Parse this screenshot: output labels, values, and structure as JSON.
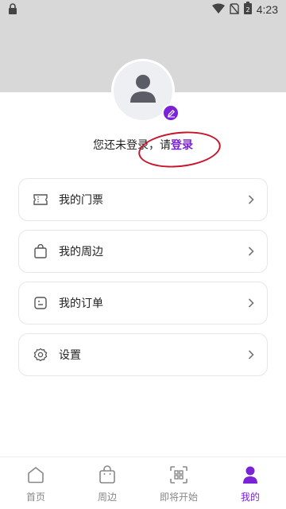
{
  "status_bar": {
    "time": "4:23"
  },
  "profile": {
    "login_prompt": "您还未登录，请",
    "login_link": "登录"
  },
  "menu": [
    {
      "label": "我的门票",
      "icon": "ticket-icon"
    },
    {
      "label": "我的周边",
      "icon": "shopping-bag-icon"
    },
    {
      "label": "我的订单",
      "icon": "order-icon"
    },
    {
      "label": "设置",
      "icon": "gear-icon"
    }
  ],
  "bottom_nav": [
    {
      "label": "首页",
      "icon": "home-icon",
      "active": false
    },
    {
      "label": "周边",
      "icon": "shopping-bag-icon",
      "active": false
    },
    {
      "label": "即将开始",
      "icon": "qr-scan-icon",
      "active": false
    },
    {
      "label": "我的",
      "icon": "person-icon",
      "active": true
    }
  ],
  "colors": {
    "accent": "#7a22d8",
    "header_gray": "#d8d8d8",
    "annotation_red": "#c6152b"
  }
}
